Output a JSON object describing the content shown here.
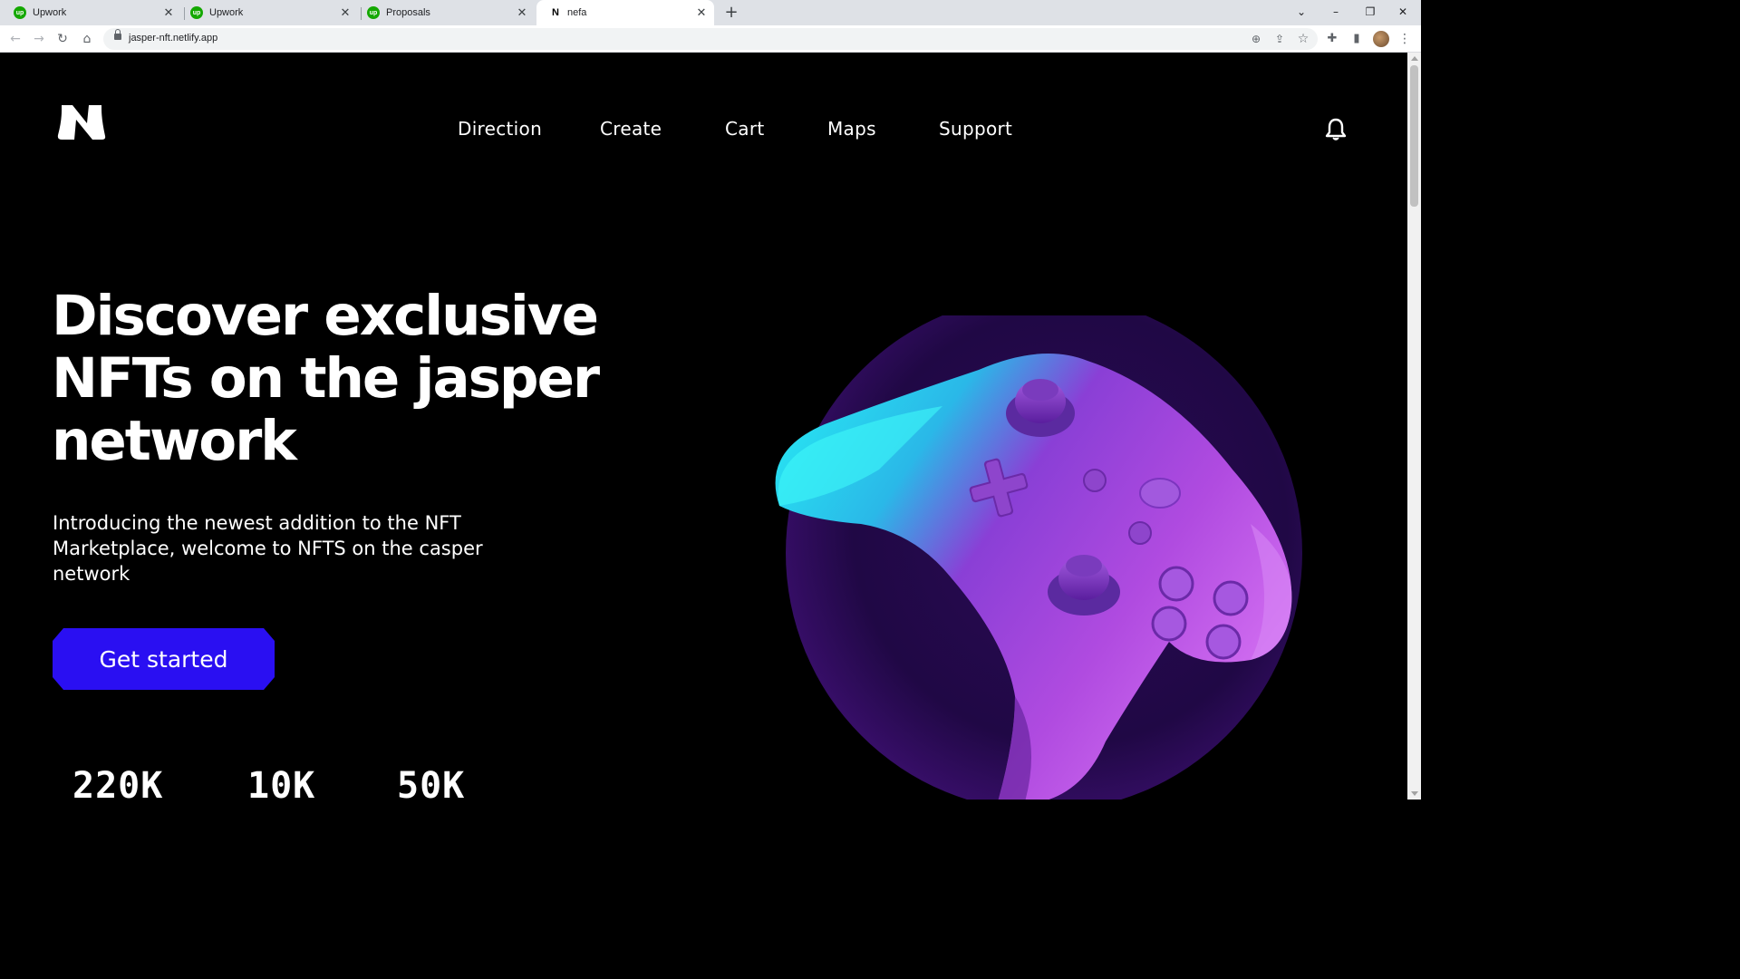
{
  "browser": {
    "tabs": [
      {
        "label": "Upwork",
        "favicon": "upwork-icon"
      },
      {
        "label": "Upwork",
        "favicon": "upwork-icon"
      },
      {
        "label": "Proposals",
        "favicon": "upwork-icon"
      },
      {
        "label": "nefa",
        "favicon": "nefa-icon",
        "active": true
      }
    ],
    "url": "jasper-nft.netlify.app"
  },
  "site": {
    "nav": [
      "Direction",
      "Create",
      "Cart",
      "Maps",
      "Support"
    ],
    "hero": {
      "title": "Discover exclusive NFTs on the jasper network",
      "subtitle": "Introducing the newest addition to the NFT Marketplace, welcome to NFTS on the casper network",
      "cta_label": "Get started"
    },
    "stats": [
      "220K",
      "10K",
      "50K"
    ]
  },
  "colors": {
    "background": "#000000",
    "accent": "#2a0ff2",
    "text": "#ffffff",
    "upwork_green": "#14a800"
  }
}
